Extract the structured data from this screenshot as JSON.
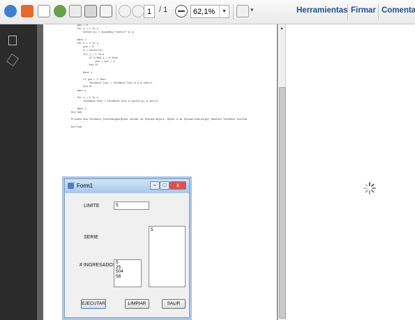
{
  "toolbar": {
    "page_current": "1",
    "page_total": "/ 1",
    "zoom": "62,1%",
    "menu": [
      "Herramientas",
      "Firmar",
      "Comentario"
    ]
  },
  "code_lines": [
    "    pos = 0",
    "    For i = 1 To n",
    "        vector(i) = InputBox(\"vector\" & i)",
    "",
    "    Next i",
    "    For k = 1 To n",
    "        pos = 0",
    "        a = vector(k)",
    "        For j = 1 To a",
    "            If a Mod j = 0 Then",
    "                pos = pos + 1",
    "            End If",
    "",
    "        Next j",
    "",
    "        If pos = 2 Then",
    "            TextBox2.Text = TextBox2.Text & a & vbCrLf",
    "        End If",
    "    Next k",
    "",
    "    For i = 1 To n",
    "        TextBox3.Text = TextBox3.Text & vector(i) & vbCrLf",
    "",
    "    Next i",
    "End Sub",
    "",
    "Private Sub TextBox1_TextChanged(ByVal sender As System.Object, ByVal e As System.EventArgs) Handles TextBox1.TextCha",
    "",
    "End Sub"
  ],
  "form": {
    "title": "Form1",
    "limite_label": "LIMITE",
    "limite_value": "5",
    "serie_label": "SERIE",
    "serie_value": "5",
    "ingresados_label": "# INGRESADOS",
    "ingresados_values": [
      "5",
      "25",
      "504",
      "58"
    ],
    "buttons": {
      "ejecutar": "EJECUTAR",
      "limpiar": "LIMPIAR",
      "salir": "SALIR"
    }
  },
  "colors": {
    "accent": "#1f4f8a",
    "doc_background": "#616161",
    "left_rail": "#2b2b2b"
  }
}
